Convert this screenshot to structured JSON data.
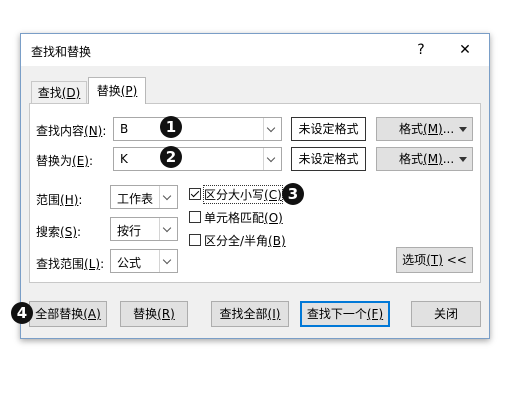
{
  "dialog": {
    "title": "查找和替换",
    "help_label": "?",
    "close_label": "✕"
  },
  "tabs": [
    {
      "label": "查找",
      "key": "(D)"
    },
    {
      "label": "替换",
      "key": "(P)"
    }
  ],
  "find": {
    "label": "查找内容",
    "key": "(N)",
    "suffix": ":",
    "value": "B",
    "format_status": "未设定格式",
    "format_button": "格式",
    "format_key": "(M)",
    "format_ellipsis": "..."
  },
  "replace": {
    "label": "替换为",
    "key": "(E)",
    "suffix": ":",
    "value": "K",
    "format_status": "未设定格式",
    "format_button": "格式",
    "format_key": "(M)",
    "format_ellipsis": "..."
  },
  "scope": {
    "label": "范围",
    "key": "(H)",
    "suffix": ":",
    "value": "工作表"
  },
  "search": {
    "label": "搜索",
    "key": "(S)",
    "suffix": ":",
    "value": "按行"
  },
  "look_in": {
    "label": "查找范围",
    "key": "(L)",
    "suffix": ":",
    "value": "公式"
  },
  "options_checks": [
    {
      "label": "区分大小写",
      "key": "(C)",
      "checked": true
    },
    {
      "label": "单元格匹配",
      "key": "(O)",
      "checked": false
    },
    {
      "label": "区分全/半角",
      "key": "(B)",
      "checked": false
    }
  ],
  "options_button": {
    "label": "选项",
    "key": "(T)",
    "arrows": "<<"
  },
  "buttons": {
    "replace_all": {
      "label": "全部替换",
      "key": "(A)"
    },
    "replace": {
      "label": "替换",
      "key": "(R)"
    },
    "find_all": {
      "label": "查找全部",
      "key": "(I)"
    },
    "find_next": {
      "label": "查找下一个",
      "key": "(F)"
    },
    "close": {
      "label": "关闭"
    }
  },
  "callouts": [
    "1",
    "2",
    "3",
    "4"
  ]
}
